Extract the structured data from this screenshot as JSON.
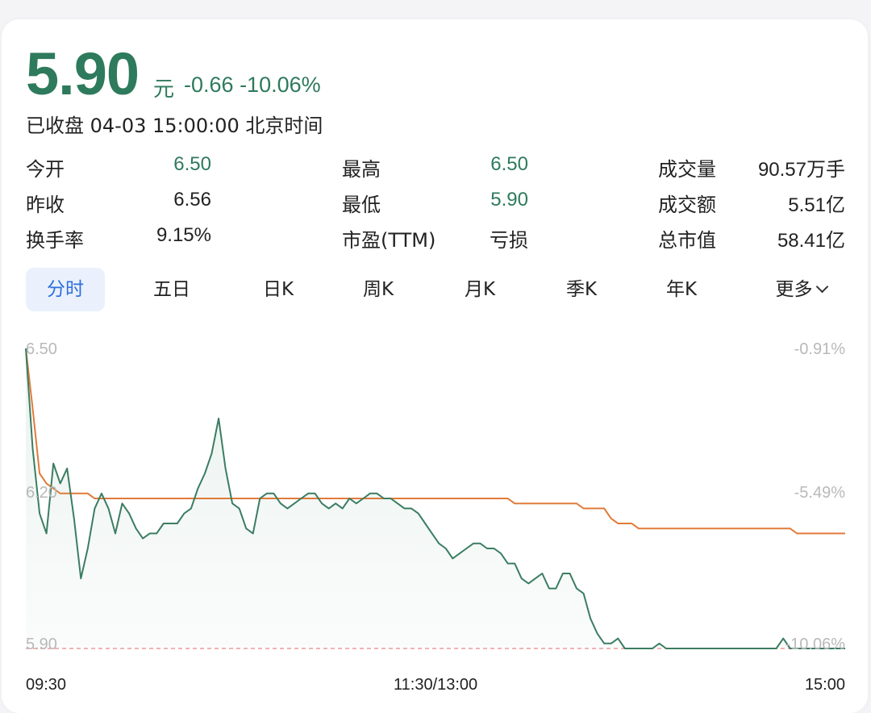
{
  "quote": {
    "price": "5.90",
    "unit": "元",
    "change": "-0.66",
    "change_pct": "-10.06%",
    "status": "已收盘 04-03 15:00:00 北京时间"
  },
  "stats": [
    {
      "label": "今开",
      "value": "6.50"
    },
    {
      "label": "最高",
      "value": "6.50"
    },
    {
      "label": "成交量",
      "value": "90.57万手"
    },
    {
      "label": "昨收",
      "value": "6.56"
    },
    {
      "label": "最低",
      "value": "5.90"
    },
    {
      "label": "成交额",
      "value": "5.51亿"
    },
    {
      "label": "换手率",
      "value": "9.15%"
    },
    {
      "label": "市盈(TTM)",
      "value": "亏损"
    },
    {
      "label": "总市值",
      "value": "58.41亿"
    }
  ],
  "tabs": [
    "分时",
    "五日",
    "日K",
    "周K",
    "月K",
    "季K",
    "年K",
    "更多"
  ],
  "active_tab": "分时",
  "colors": {
    "down": "#2e7a5c",
    "price_line": "#3b7d62",
    "avg_line": "#e07b39",
    "limit_line": "#f09a9a",
    "tab_active_bg": "#eaf1fd",
    "tab_active_text": "#2e6fdc"
  },
  "icons": {
    "more": "chevron-down-icon"
  },
  "chart_data": {
    "type": "line",
    "ylim": [
      5.9,
      6.5
    ],
    "y_ticks_left": [
      "6.50",
      "6.20",
      "5.90"
    ],
    "y_ticks_right": [
      "-0.91%",
      "-5.49%",
      "-10.06%"
    ],
    "x_ticks": [
      "09:30",
      "11:30/13:00",
      "15:00"
    ],
    "limit_down": 5.9,
    "series": [
      {
        "values": [
          6.5,
          6.3,
          6.17,
          6.13,
          6.27,
          6.23,
          6.26,
          6.16,
          6.04,
          6.1,
          6.18,
          6.21,
          6.18,
          6.13,
          6.19,
          6.17,
          6.14,
          6.12,
          6.13,
          6.13,
          6.15,
          6.15,
          6.15,
          6.17,
          6.18,
          6.22,
          6.25,
          6.29,
          6.36,
          6.26,
          6.19,
          6.18,
          6.14,
          6.13,
          6.2,
          6.21,
          6.21,
          6.19,
          6.18,
          6.19,
          6.2,
          6.21,
          6.21,
          6.19,
          6.18,
          6.19,
          6.18,
          6.2,
          6.19,
          6.2,
          6.21,
          6.21,
          6.2,
          6.2,
          6.19,
          6.18,
          6.18,
          6.17,
          6.15,
          6.13,
          6.11,
          6.1,
          6.08,
          6.09,
          6.1,
          6.11,
          6.11,
          6.1,
          6.1,
          6.09,
          6.07,
          6.07,
          6.04,
          6.03,
          6.04,
          6.05,
          6.02,
          6.02,
          6.05,
          6.05,
          6.02,
          6.01,
          5.96,
          5.93,
          5.91,
          5.91,
          5.92,
          5.9,
          5.9,
          5.9,
          5.9,
          5.9,
          5.91,
          5.9,
          5.9,
          5.9,
          5.9,
          5.9,
          5.9,
          5.9,
          5.9,
          5.9,
          5.9,
          5.9,
          5.9,
          5.9,
          5.9,
          5.9,
          5.9,
          5.9,
          5.92,
          5.9,
          5.9,
          5.9,
          5.9,
          5.9,
          5.9,
          5.9,
          5.9,
          5.9
        ]
      },
      {
        "values": [
          6.5,
          6.38,
          6.25,
          6.23,
          6.22,
          6.21,
          6.21,
          6.21,
          6.21,
          6.21,
          6.2,
          6.2,
          6.2,
          6.2,
          6.2,
          6.2,
          6.2,
          6.2,
          6.2,
          6.2,
          6.2,
          6.2,
          6.2,
          6.2,
          6.2,
          6.2,
          6.2,
          6.2,
          6.2,
          6.2,
          6.2,
          6.2,
          6.2,
          6.2,
          6.2,
          6.2,
          6.2,
          6.2,
          6.2,
          6.2,
          6.2,
          6.2,
          6.2,
          6.2,
          6.2,
          6.2,
          6.2,
          6.2,
          6.2,
          6.2,
          6.2,
          6.2,
          6.2,
          6.2,
          6.2,
          6.2,
          6.2,
          6.2,
          6.2,
          6.2,
          6.2,
          6.2,
          6.2,
          6.2,
          6.2,
          6.2,
          6.2,
          6.2,
          6.2,
          6.2,
          6.2,
          6.19,
          6.19,
          6.19,
          6.19,
          6.19,
          6.19,
          6.19,
          6.19,
          6.19,
          6.19,
          6.18,
          6.18,
          6.18,
          6.18,
          6.16,
          6.15,
          6.15,
          6.15,
          6.14,
          6.14,
          6.14,
          6.14,
          6.14,
          6.14,
          6.14,
          6.14,
          6.14,
          6.14,
          6.14,
          6.14,
          6.14,
          6.14,
          6.14,
          6.14,
          6.14,
          6.14,
          6.14,
          6.14,
          6.14,
          6.14,
          6.14,
          6.13,
          6.13,
          6.13,
          6.13,
          6.13,
          6.13,
          6.13,
          6.13
        ]
      }
    ]
  }
}
